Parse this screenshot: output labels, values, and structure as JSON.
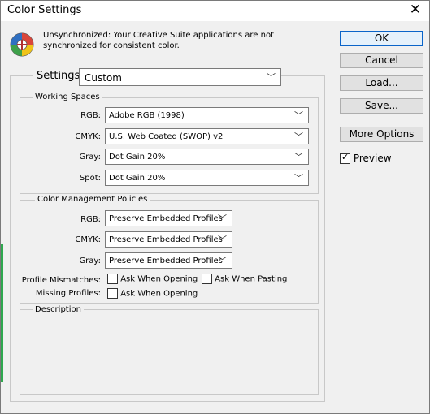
{
  "window": {
    "title": "Color Settings",
    "close_glyph": "✕"
  },
  "message": {
    "line1": "Unsynchronized: Your Creative Suite applications are not",
    "line2": "synchronized for consistent color."
  },
  "buttons": {
    "ok": "OK",
    "cancel": "Cancel",
    "load": "Load...",
    "save": "Save...",
    "more_options": "More Options"
  },
  "preview": {
    "label": "Preview",
    "checked": true
  },
  "settings": {
    "label": "Settings:",
    "value": "Custom"
  },
  "working_spaces": {
    "legend": "Working Spaces",
    "rgb": {
      "label": "RGB:",
      "value": "Adobe RGB (1998)"
    },
    "cmyk": {
      "label": "CMYK:",
      "value": "U.S. Web Coated (SWOP) v2"
    },
    "gray": {
      "label": "Gray:",
      "value": "Dot Gain 20%"
    },
    "spot": {
      "label": "Spot:",
      "value": "Dot Gain 20%"
    }
  },
  "policies": {
    "legend": "Color Management Policies",
    "rgb": {
      "label": "RGB:",
      "value": "Preserve Embedded Profiles"
    },
    "cmyk": {
      "label": "CMYK:",
      "value": "Preserve Embedded Profiles"
    },
    "gray": {
      "label": "Gray:",
      "value": "Preserve Embedded Profiles"
    },
    "profile_mismatches": {
      "label": "Profile Mismatches:",
      "ask_opening": "Ask When Opening",
      "ask_pasting": "Ask When Pasting"
    },
    "missing_profiles": {
      "label": "Missing Profiles:",
      "ask_opening": "Ask When Opening"
    }
  },
  "description": {
    "legend": "Description"
  }
}
